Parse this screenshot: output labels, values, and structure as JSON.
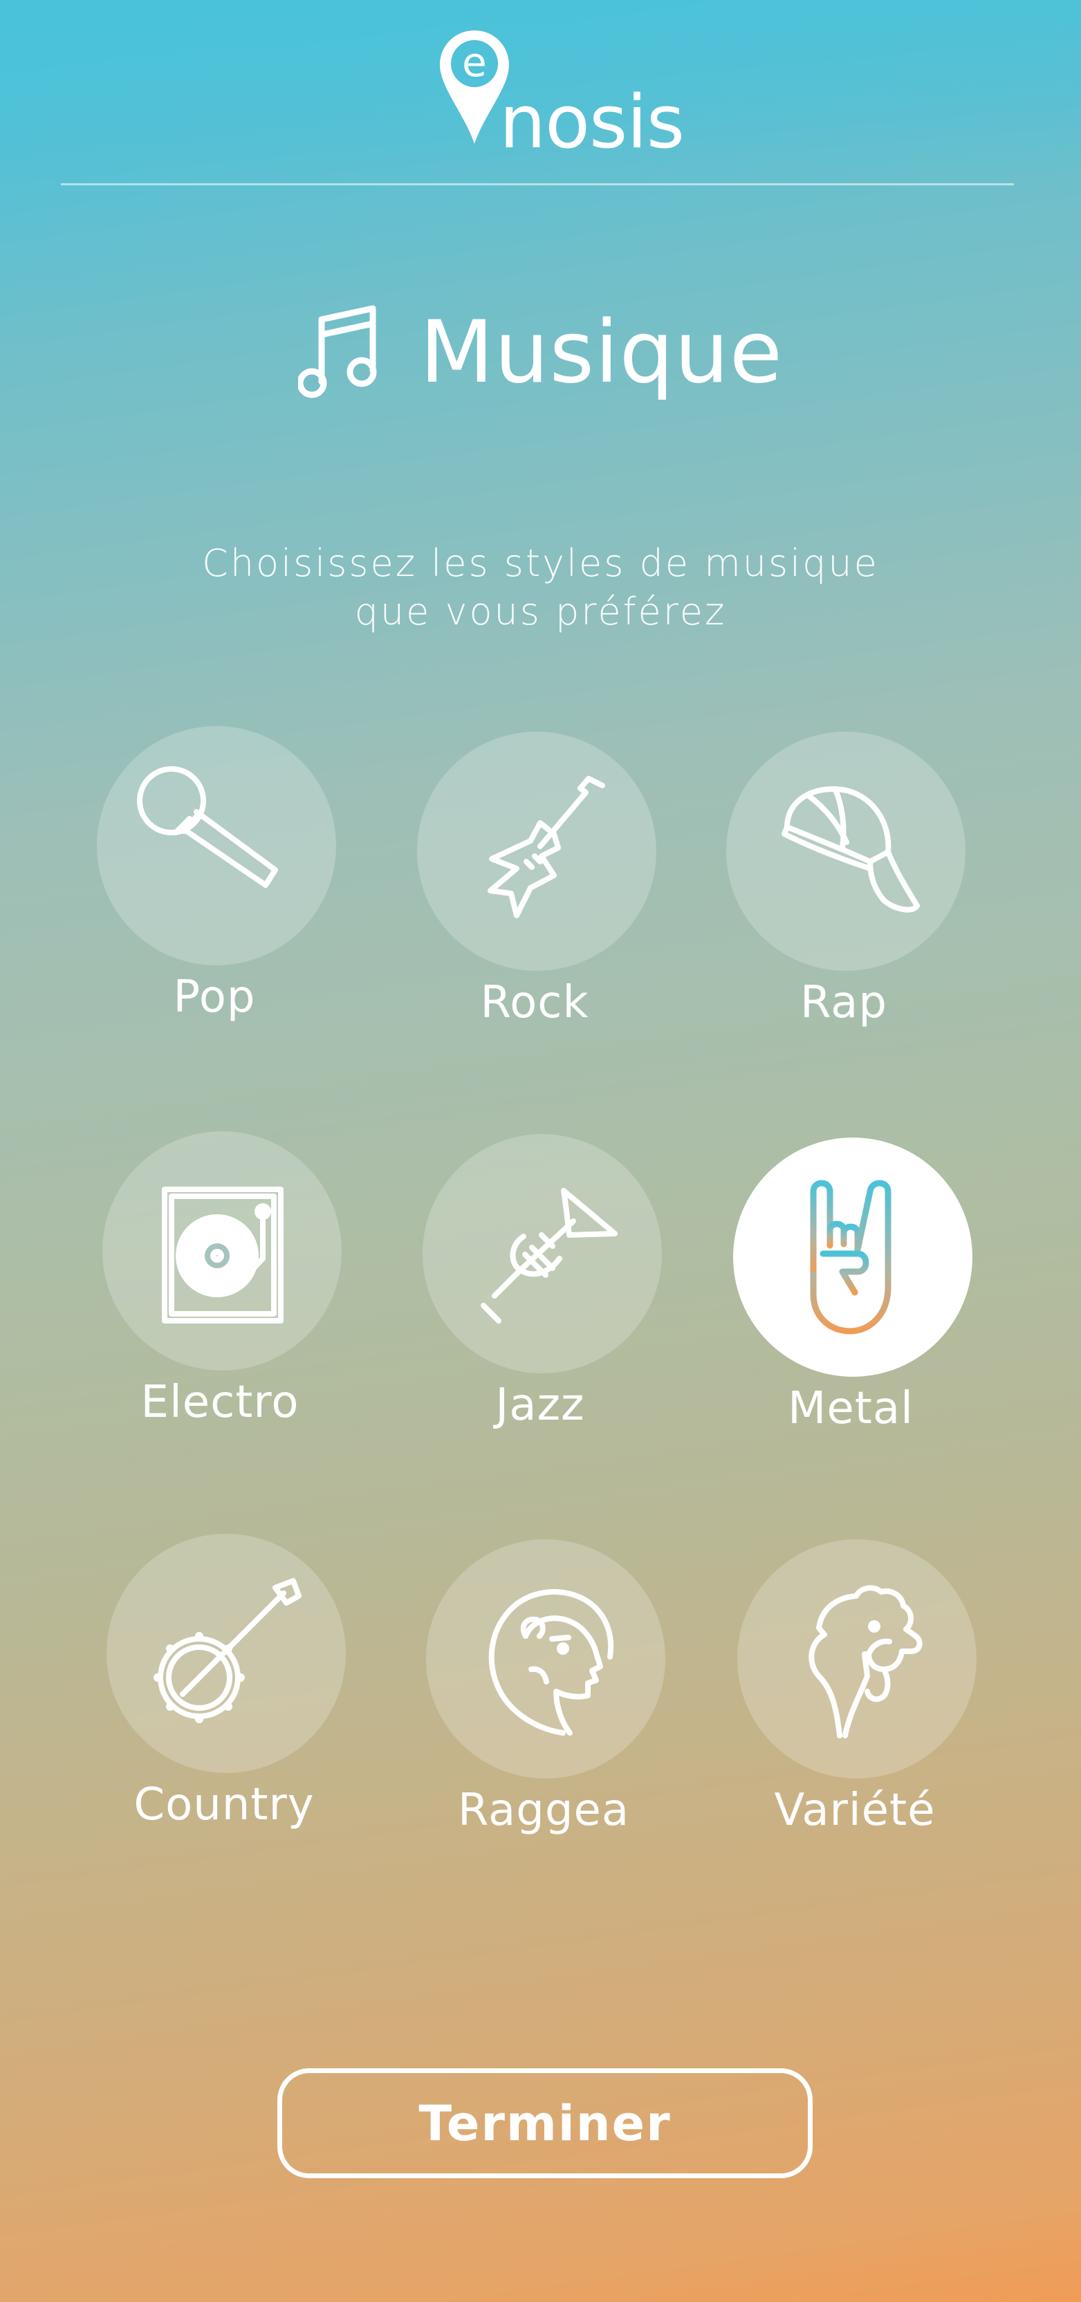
{
  "app": {
    "logo_text": "nosis",
    "logo_mark": "e",
    "brand_color": "#49c3da",
    "accent_color": "#f09c55"
  },
  "page": {
    "title": "Musique",
    "title_icon": "music-note-icon",
    "subtitle_line1": "Choisissez les styles de musique",
    "subtitle_line2": "que vous préférez"
  },
  "genres": [
    {
      "label": "Pop",
      "icon": "microphone-icon",
      "selected": false
    },
    {
      "label": "Rock",
      "icon": "electric-guitar-icon",
      "selected": false
    },
    {
      "label": "Rap",
      "icon": "cap-icon",
      "selected": false
    },
    {
      "label": "Electro",
      "icon": "turntable-icon",
      "selected": false
    },
    {
      "label": "Jazz",
      "icon": "trumpet-icon",
      "selected": false
    },
    {
      "label": "Metal",
      "icon": "rock-hand-icon",
      "selected": true
    },
    {
      "label": "Country",
      "icon": "banjo-icon",
      "selected": false
    },
    {
      "label": "Raggea",
      "icon": "lion-head-icon",
      "selected": false
    },
    {
      "label": "Variété",
      "icon": "rooster-icon",
      "selected": false
    }
  ],
  "actions": {
    "finish_label": "Terminer"
  }
}
